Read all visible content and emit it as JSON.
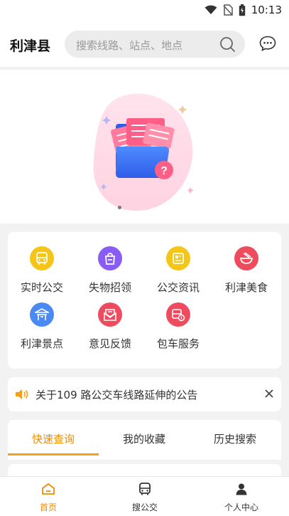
{
  "status": {
    "time": "10:13"
  },
  "header": {
    "city": "利津县",
    "search_placeholder": "搜索线路、站点、地点"
  },
  "menu": [
    {
      "label": "实时公交",
      "icon": "bus-icon",
      "color": "#f5c518"
    },
    {
      "label": "失物招领",
      "icon": "bag-icon",
      "color": "#8a5cf6"
    },
    {
      "label": "公交资讯",
      "icon": "news-icon",
      "color": "#f5c518"
    },
    {
      "label": "利津美食",
      "icon": "food-bowl-icon",
      "color": "#ef4b5f"
    },
    {
      "label": "利津景点",
      "icon": "pavilion-icon",
      "color": "#4b8af5"
    },
    {
      "label": "意见反馈",
      "icon": "feedback-mail-icon",
      "color": "#ef4b5f"
    },
    {
      "label": "包车服务",
      "icon": "charter-bus-icon",
      "color": "#ef4b5f"
    }
  ],
  "notice": {
    "text": "关于109 路公交车线路延伸的公告"
  },
  "tabs": [
    {
      "label": "快速查询",
      "active": true
    },
    {
      "label": "我的收藏",
      "active": false
    },
    {
      "label": "历史搜索",
      "active": false
    }
  ],
  "bottom_nav": [
    {
      "label": "首页",
      "icon": "home-icon",
      "active": true
    },
    {
      "label": "搜公交",
      "icon": "bus-icon",
      "active": false
    },
    {
      "label": "个人中心",
      "icon": "person-icon",
      "active": false
    }
  ],
  "colors": {
    "accent": "#f08c00",
    "background": "#f2f2f2"
  }
}
